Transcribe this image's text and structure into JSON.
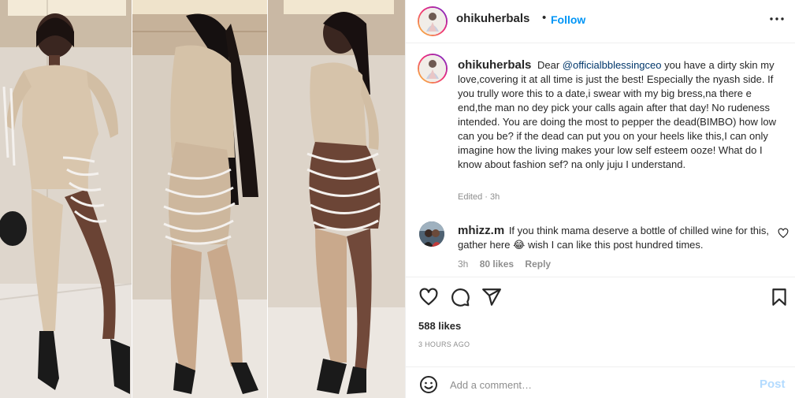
{
  "post": {
    "username": "ohikuherbals",
    "separator": "•",
    "follow_label": "Follow",
    "more_icon": "more-horizontal-icon"
  },
  "caption": {
    "username": "ohikuherbals",
    "text_before": "Dear",
    "mention": "@officialbblessingceo",
    "text_after": "you have a dirty skin my love,covering it at all time is just the best! Especially the nyash side. If you trully wore this to a date,i swear with my big bress,na there e end,the man no dey pick your calls again after that day! No rudeness intended. You are doing the most to pepper the dead(BIMBO) how low can you be? if the dead can put you on your heels like this,I can only imagine how the living makes your low self esteem ooze! What do I know about fashion sef? na only juju I understand.",
    "edited": "Edited · 3h"
  },
  "reply": {
    "username": "mhizz.m",
    "text_before": "If you think mama deserve a bottle of chilled wine for this, gather here",
    "emoji": "😂",
    "text_after": "wish I can like this post hundred times.",
    "time": "3h",
    "likes": "80 likes",
    "reply_label": "Reply"
  },
  "actions": {
    "icons": [
      "heart-icon",
      "comment-icon",
      "share-icon",
      "bookmark-icon"
    ]
  },
  "likes": "588 likes",
  "timestamp": "3 HOURS AGO",
  "add_comment": {
    "placeholder": "Add a comment…",
    "post_label": "Post"
  },
  "colors": {
    "accent": "#0095f6",
    "post_disabled": "#b3dbff",
    "mention": "#00376b",
    "secondary_text": "#8e8e8e"
  }
}
